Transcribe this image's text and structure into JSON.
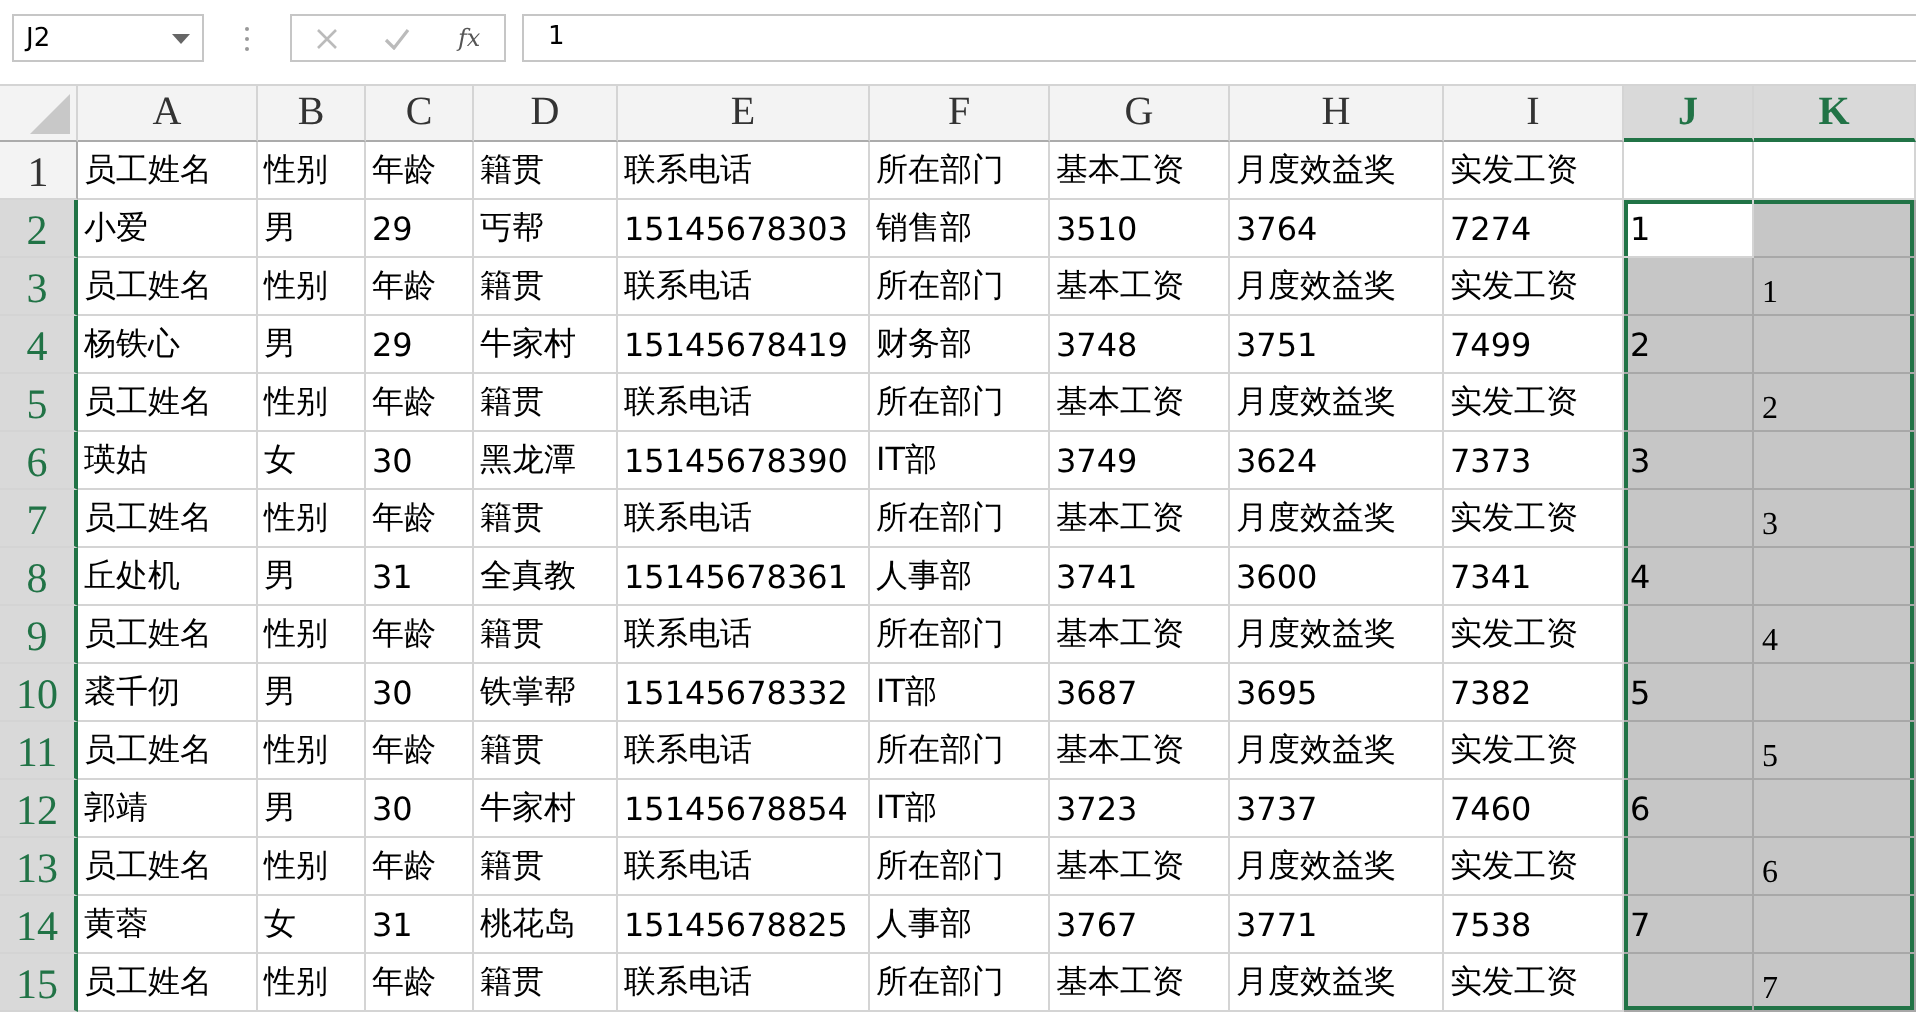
{
  "formula_bar": {
    "name_box": "J2",
    "function_label": "fx",
    "value": "1"
  },
  "columns": [
    {
      "label": "A",
      "selected": false
    },
    {
      "label": "B",
      "selected": false
    },
    {
      "label": "C",
      "selected": false
    },
    {
      "label": "D",
      "selected": false
    },
    {
      "label": "E",
      "selected": false
    },
    {
      "label": "F",
      "selected": false
    },
    {
      "label": "G",
      "selected": false
    },
    {
      "label": "H",
      "selected": false
    },
    {
      "label": "I",
      "selected": false
    },
    {
      "label": "J",
      "selected": true
    },
    {
      "label": "K",
      "selected": true
    }
  ],
  "rows": [
    {
      "header": "1",
      "selected": false,
      "active": false,
      "cells": [
        "员工姓名",
        "性别",
        "年龄",
        "籍贯",
        "联系电话",
        "所在部门",
        "基本工资",
        "月度效益奖",
        "实发工资",
        null,
        null
      ]
    },
    {
      "header": "2",
      "selected": true,
      "active": true,
      "cells": [
        "小爱",
        "男",
        "29",
        "丐帮",
        "15145678303",
        "销售部",
        "3510",
        "3764",
        "7274",
        "1",
        null
      ]
    },
    {
      "header": "3",
      "selected": true,
      "active": false,
      "cells": [
        "员工姓名",
        "性别",
        "年龄",
        "籍贯",
        "联系电话",
        "所在部门",
        "基本工资",
        "月度效益奖",
        "实发工资",
        null,
        "1"
      ]
    },
    {
      "header": "4",
      "selected": true,
      "active": false,
      "cells": [
        "杨铁心",
        "男",
        "29",
        "牛家村",
        "15145678419",
        "财务部",
        "3748",
        "3751",
        "7499",
        "2",
        null
      ]
    },
    {
      "header": "5",
      "selected": true,
      "active": false,
      "cells": [
        "员工姓名",
        "性别",
        "年龄",
        "籍贯",
        "联系电话",
        "所在部门",
        "基本工资",
        "月度效益奖",
        "实发工资",
        null,
        "2"
      ]
    },
    {
      "header": "6",
      "selected": true,
      "active": false,
      "cells": [
        "瑛姑",
        "女",
        "30",
        "黑龙潭",
        "15145678390",
        "IT部",
        "3749",
        "3624",
        "7373",
        "3",
        null
      ]
    },
    {
      "header": "7",
      "selected": true,
      "active": false,
      "cells": [
        "员工姓名",
        "性别",
        "年龄",
        "籍贯",
        "联系电话",
        "所在部门",
        "基本工资",
        "月度效益奖",
        "实发工资",
        null,
        "3"
      ]
    },
    {
      "header": "8",
      "selected": true,
      "active": false,
      "cells": [
        "丘处机",
        "男",
        "31",
        "全真教",
        "15145678361",
        "人事部",
        "3741",
        "3600",
        "7341",
        "4",
        null
      ]
    },
    {
      "header": "9",
      "selected": true,
      "active": false,
      "cells": [
        "员工姓名",
        "性别",
        "年龄",
        "籍贯",
        "联系电话",
        "所在部门",
        "基本工资",
        "月度效益奖",
        "实发工资",
        null,
        "4"
      ]
    },
    {
      "header": "10",
      "selected": true,
      "active": false,
      "cells": [
        "裘千仞",
        "男",
        "30",
        "铁掌帮",
        "15145678332",
        "IT部",
        "3687",
        "3695",
        "7382",
        "5",
        null
      ]
    },
    {
      "header": "11",
      "selected": true,
      "active": false,
      "cells": [
        "员工姓名",
        "性别",
        "年龄",
        "籍贯",
        "联系电话",
        "所在部门",
        "基本工资",
        "月度效益奖",
        "实发工资",
        null,
        "5"
      ]
    },
    {
      "header": "12",
      "selected": true,
      "active": false,
      "cells": [
        "郭靖",
        "男",
        "30",
        "牛家村",
        "15145678854",
        "IT部",
        "3723",
        "3737",
        "7460",
        "6",
        null
      ]
    },
    {
      "header": "13",
      "selected": true,
      "active": false,
      "cells": [
        "员工姓名",
        "性别",
        "年龄",
        "籍贯",
        "联系电话",
        "所在部门",
        "基本工资",
        "月度效益奖",
        "实发工资",
        null,
        "6"
      ]
    },
    {
      "header": "14",
      "selected": true,
      "active": false,
      "cells": [
        "黄蓉",
        "女",
        "31",
        "桃花岛",
        "15145678825",
        "人事部",
        "3767",
        "3771",
        "7538",
        "7",
        null
      ]
    },
    {
      "header": "15",
      "selected": true,
      "active": false,
      "cells": [
        "员工姓名",
        "性别",
        "年龄",
        "籍贯",
        "联系电话",
        "所在部门",
        "基本工资",
        "月度效益奖",
        "实发工资",
        null,
        "7"
      ]
    }
  ]
}
